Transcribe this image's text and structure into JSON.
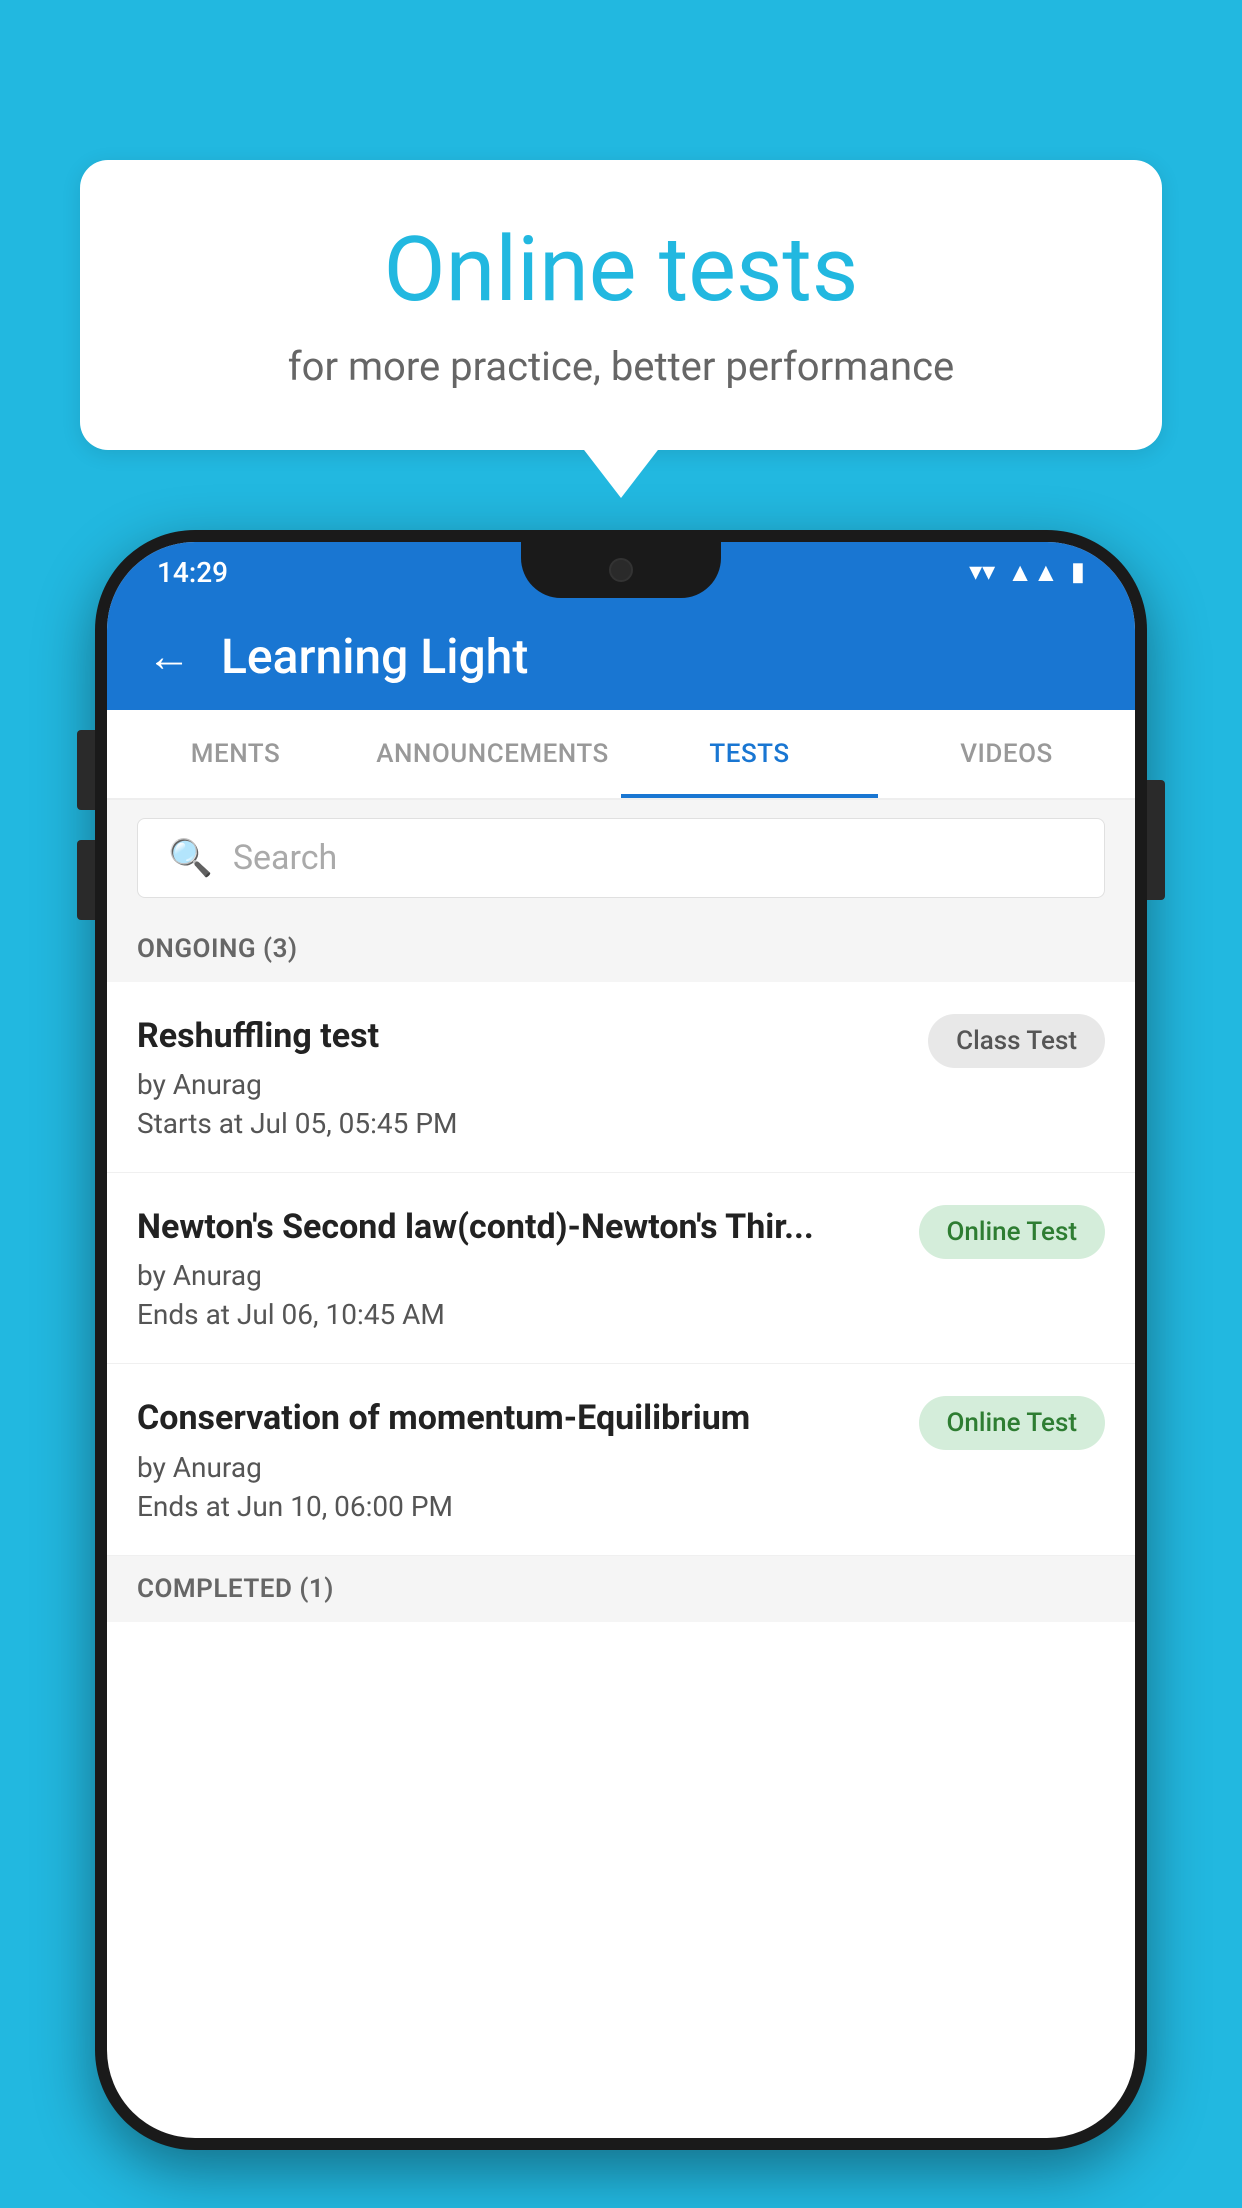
{
  "background": {
    "color": "#22B8E0"
  },
  "speech_bubble": {
    "title": "Online tests",
    "subtitle": "for more practice, better performance"
  },
  "status_bar": {
    "time": "14:29",
    "wifi": "▼",
    "signal": "▲",
    "battery": "▮"
  },
  "header": {
    "title": "Learning Light",
    "back_label": "←"
  },
  "tabs": [
    {
      "label": "MENTS",
      "active": false
    },
    {
      "label": "ANNOUNCEMENTS",
      "active": false
    },
    {
      "label": "TESTS",
      "active": true
    },
    {
      "label": "VIDEOS",
      "active": false
    }
  ],
  "search": {
    "placeholder": "Search"
  },
  "sections": [
    {
      "header": "ONGOING (3)",
      "items": [
        {
          "name": "Reshuffling test",
          "author": "by Anurag",
          "time_label": "Starts at",
          "time_value": "Jul 05, 05:45 PM",
          "badge": "Class Test",
          "badge_type": "class"
        },
        {
          "name": "Newton's Second law(contd)-Newton's Thir...",
          "author": "by Anurag",
          "time_label": "Ends at",
          "time_value": "Jul 06, 10:45 AM",
          "badge": "Online Test",
          "badge_type": "online"
        },
        {
          "name": "Conservation of momentum-Equilibrium",
          "author": "by Anurag",
          "time_label": "Ends at",
          "time_value": "Jun 10, 06:00 PM",
          "badge": "Online Test",
          "badge_type": "online"
        }
      ]
    }
  ],
  "completed_header": "COMPLETED (1)"
}
